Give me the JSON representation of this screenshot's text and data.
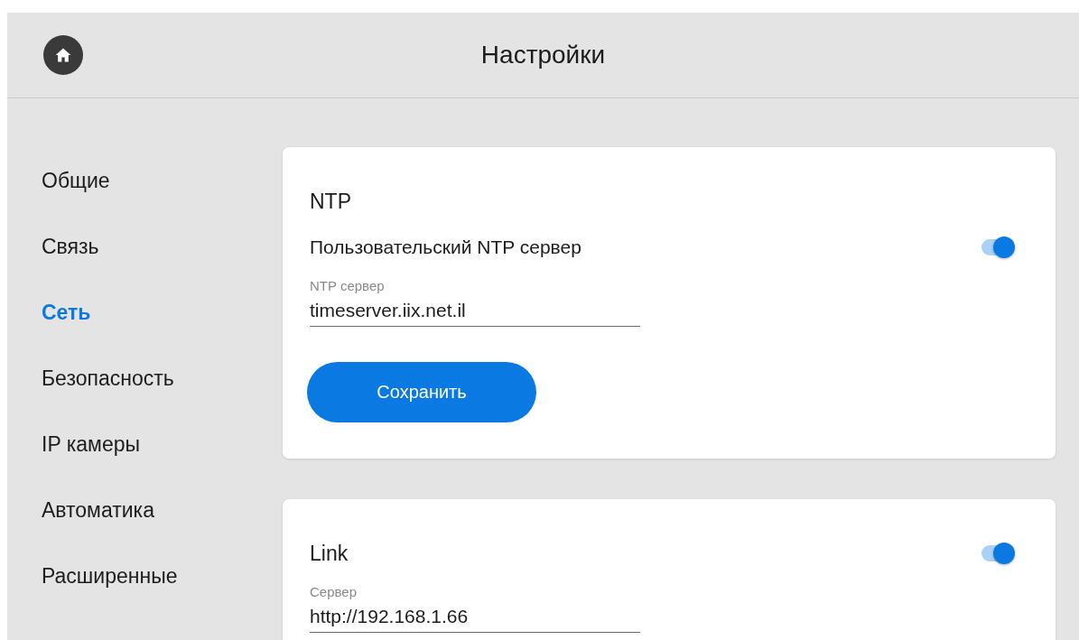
{
  "header": {
    "title": "Настройки"
  },
  "sidebar": {
    "items": [
      {
        "label": "Общие",
        "selected": false
      },
      {
        "label": "Связь",
        "selected": false
      },
      {
        "label": "Сеть",
        "selected": true
      },
      {
        "label": "Безопасность",
        "selected": false
      },
      {
        "label": "IP камеры",
        "selected": false
      },
      {
        "label": "Автоматика",
        "selected": false
      },
      {
        "label": "Расширенные",
        "selected": false
      }
    ]
  },
  "sections": [
    {
      "title": "NTP",
      "rows": [
        {
          "kind": "switch",
          "label": "Пользовательский NTP сервер",
          "on": true
        },
        {
          "kind": "field",
          "label": "NTP сервер",
          "value": "timeserver.iix.net.il"
        },
        {
          "kind": "button",
          "label": "Сохранить"
        }
      ]
    },
    {
      "title": "Link",
      "on": true,
      "rows": [
        {
          "kind": "field",
          "label": "Сервер",
          "value": "http://192.168.1.66"
        }
      ]
    }
  ]
}
